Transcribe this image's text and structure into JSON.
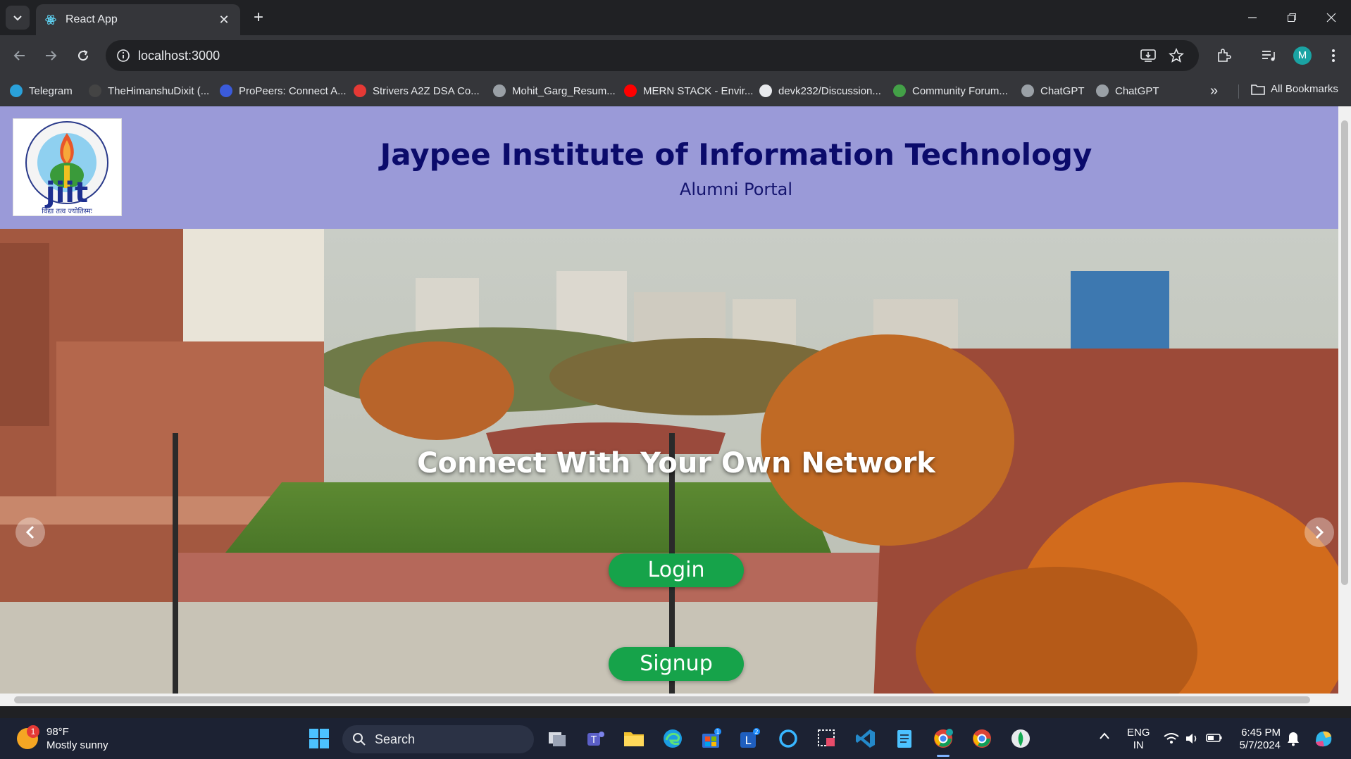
{
  "browser": {
    "tab_title": "React App",
    "url": "localhost:3000",
    "avatar_letter": "M",
    "bookmarks": [
      {
        "label": "Telegram",
        "color": "#2aa1da"
      },
      {
        "label": "TheHimanshuDixit (...",
        "color": "#444444"
      },
      {
        "label": "ProPeers: Connect A...",
        "color": "#3b5bdb"
      },
      {
        "label": "Strivers A2Z DSA Co...",
        "color": "#e53935"
      },
      {
        "label": "Mohit_Garg_Resum...",
        "color": "#9aa0a6"
      },
      {
        "label": "MERN STACK - Envir...",
        "color": "#ff0000"
      },
      {
        "label": "devk232/Discussion...",
        "color": "#e8eaed"
      },
      {
        "label": "Community Forum...",
        "color": "#43a047"
      },
      {
        "label": "ChatGPT",
        "color": "#9aa0a6"
      },
      {
        "label": "ChatGPT",
        "color": "#9aa0a6"
      }
    ],
    "all_bookmarks_label": "All Bookmarks"
  },
  "page": {
    "title": "Jaypee Institute of Information Technology",
    "subtitle": "Alumni Portal",
    "logo_text": "jiit",
    "logo_motto": "विद्या तत्व ज्योतिस्मः",
    "logo_ring_text": "JAYPEE INSTITUTE OF INFORMATION TECHNOLOGY",
    "hero_heading": "Connect With Your Own Network",
    "login_label": "Login",
    "signup_label": "Signup"
  },
  "taskbar": {
    "weather_temp": "98°F",
    "weather_desc": "Mostly sunny",
    "weather_badge": "1",
    "search_label": "Search",
    "store_badge": "1",
    "l_badge": "2",
    "lang_top": "ENG",
    "lang_bottom": "IN",
    "time": "6:45 PM",
    "date": "5/7/2024"
  },
  "colors": {
    "header_bg": "#9a9ad8",
    "title": "#0b0b6b",
    "cta": "#16a34a"
  }
}
